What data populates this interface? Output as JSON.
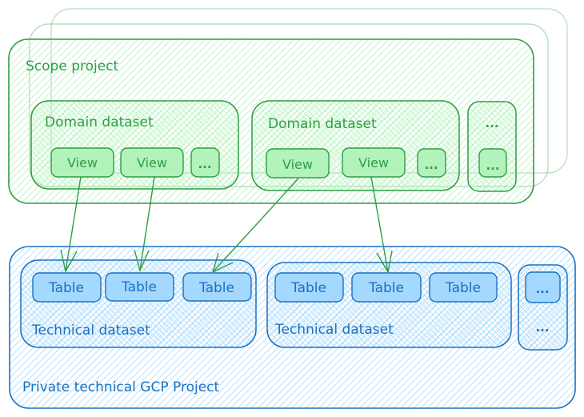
{
  "colors": {
    "green_stroke": "#2f9e44",
    "green_fill": "#b2f2bb",
    "blue_stroke": "#1971c2",
    "blue_fill": "#a5d8ff"
  },
  "scope_project": {
    "label": "Scope project",
    "domain_datasets": [
      {
        "label": "Domain dataset",
        "views": [
          "View",
          "View",
          "..."
        ]
      },
      {
        "label": "Domain dataset",
        "views": [
          "View",
          "View",
          "..."
        ]
      }
    ],
    "more_dataset": {
      "label": "...",
      "item": "..."
    }
  },
  "technical_project": {
    "label": "Private technical GCP Project",
    "technical_datasets": [
      {
        "label": "Technical dataset",
        "tables": [
          "Table",
          "Table",
          "Table"
        ]
      },
      {
        "label": "Technical dataset",
        "tables": [
          "Table",
          "Table",
          "Table"
        ]
      }
    ],
    "more_dataset": {
      "label": "...",
      "item": "..."
    }
  },
  "arrows": [
    {
      "from": "dataset1-view1",
      "to": "techdataset1-table1"
    },
    {
      "from": "dataset1-view2",
      "to": "techdataset1-table2"
    },
    {
      "from": "dataset2-view1",
      "to": "techdataset1-table3"
    },
    {
      "from": "dataset2-view2",
      "to": "techdataset2-table2"
    }
  ]
}
